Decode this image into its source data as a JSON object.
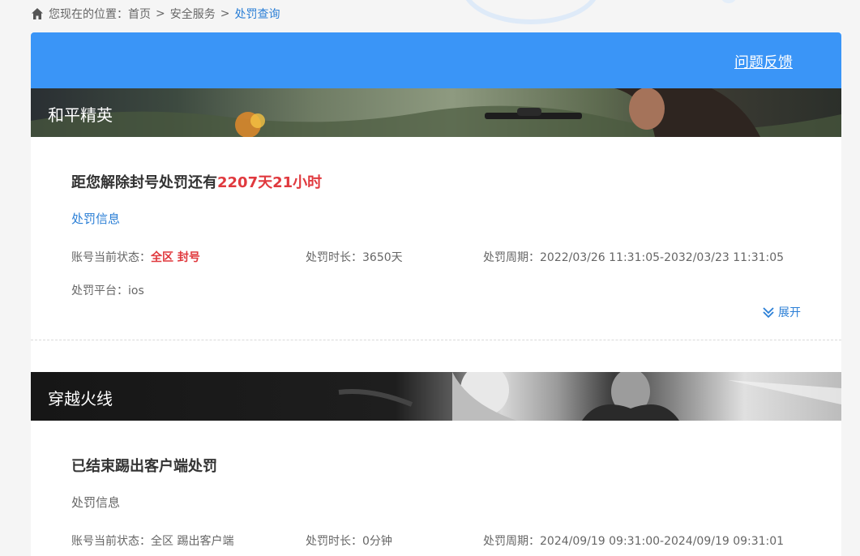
{
  "breadcrumb": {
    "prefix": "您现在的位置：",
    "items": [
      "首页",
      "安全服务"
    ],
    "separator": ">",
    "current": "处罚查询"
  },
  "topbar": {
    "feedback_label": "问题反馈"
  },
  "games": [
    {
      "name": "和平精英",
      "headline_prefix": "距您解除封号处罚还有",
      "headline_highlight": "2207天21小时",
      "info_label": "处罚信息",
      "status_label": "账号当前状态：",
      "status_value": "全区 封号",
      "duration": "处罚时长：3650天",
      "period": "处罚周期：2022/03/26 11:31:05-2032/03/23 11:31:05",
      "platform": "处罚平台：ios",
      "expand_label": "展开"
    },
    {
      "name": "穿越火线",
      "headline": "已结束踢出客户端处罚",
      "info_label": "处罚信息",
      "status_label": "账号当前状态：",
      "status_value": "全区 踢出客户端",
      "duration": "处罚时长：0分钟",
      "period": "处罚周期：2024/09/19 09:31:00-2024/09/19 09:31:01"
    }
  ],
  "colors": {
    "accent": "#3a95f7",
    "link": "#2b7fd6",
    "alert": "#e0393e"
  }
}
